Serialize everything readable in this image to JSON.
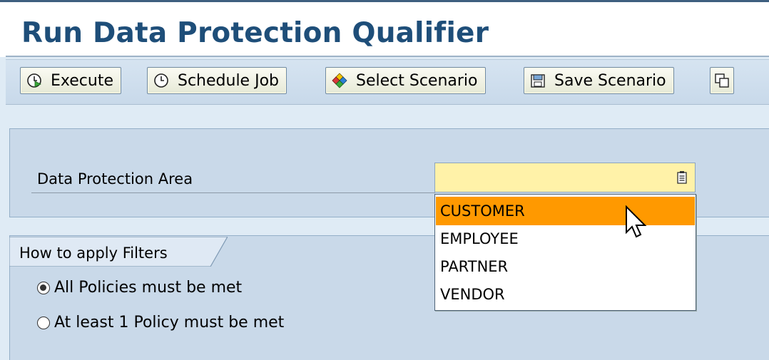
{
  "window": {
    "title": "Run Data Protection Qualifier"
  },
  "toolbar": {
    "execute_label": "Execute",
    "schedule_label": "Schedule Job",
    "select_scenario_label": "Select Scenario",
    "save_scenario_label": "Save Scenario"
  },
  "criteria": {
    "data_protection_area_label": "Data Protection Area",
    "data_protection_area_value": "",
    "options": [
      "CUSTOMER",
      "EMPLOYEE",
      "PARTNER",
      "VENDOR"
    ],
    "highlighted_option": "CUSTOMER"
  },
  "filters": {
    "heading": "How to apply Filters",
    "all_policies_label": "All Policies must be met",
    "at_least_one_label": "At least 1 Policy must be met",
    "selected": "All Policies must be met"
  },
  "colors": {
    "title": "#1e4e79",
    "field_bg": "#fff2a8",
    "highlight": "#ff9900",
    "panel_bg": "#c9d9e9"
  }
}
